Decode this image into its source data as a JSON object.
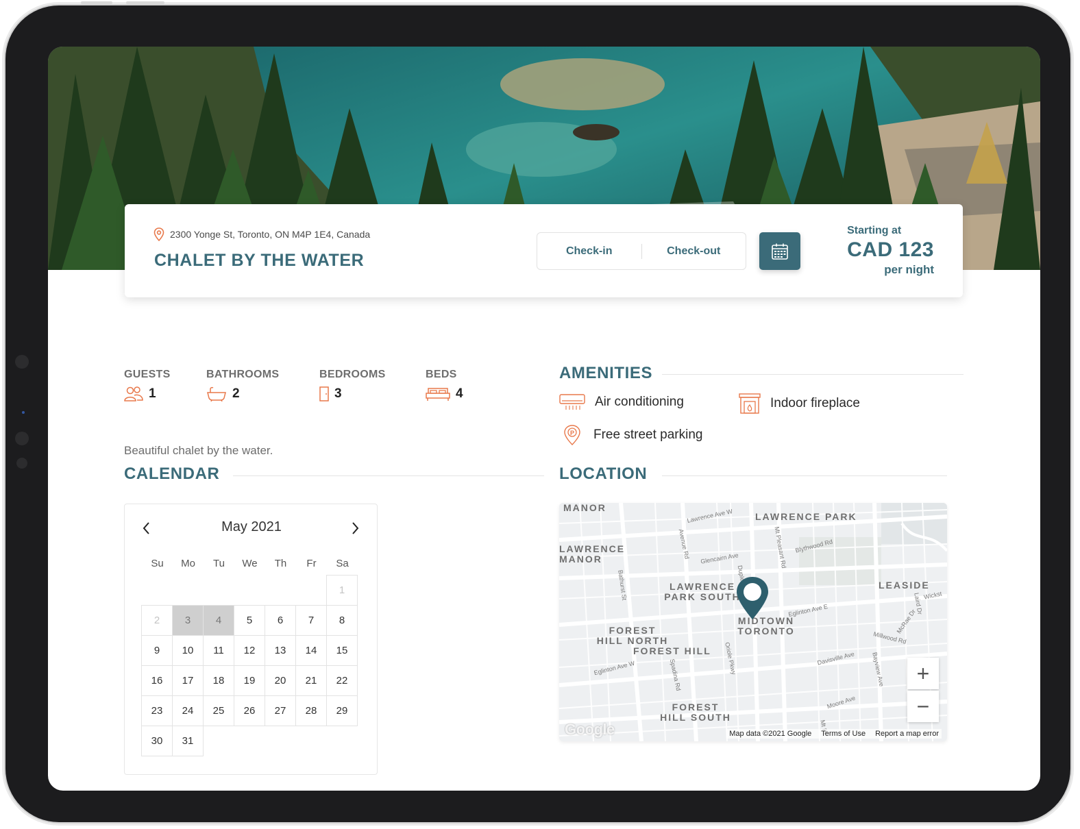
{
  "listing": {
    "address": "2300 Yonge St, Toronto, ON M4P 1E4, Canada",
    "title": "CHALET BY THE WATER",
    "checkin_label": "Check-in",
    "checkout_label": "Check-out",
    "price_prefix": "Starting at",
    "price": "CAD 123",
    "price_suffix": "per night",
    "description": "Beautiful chalet by the water."
  },
  "stats": [
    {
      "label": "GUESTS",
      "value": "1",
      "icon": "guests-icon"
    },
    {
      "label": "BATHROOMS",
      "value": "2",
      "icon": "bathtub-icon"
    },
    {
      "label": "BEDROOMS",
      "value": "3",
      "icon": "door-icon"
    },
    {
      "label": "BEDS",
      "value": "4",
      "icon": "bed-icon"
    }
  ],
  "amenities": {
    "heading": "AMENITIES",
    "items": [
      {
        "label": "Air conditioning",
        "icon": "air-conditioner-icon"
      },
      {
        "label": "Indoor fireplace",
        "icon": "fireplace-icon"
      },
      {
        "label": "Free street parking",
        "icon": "parking-icon"
      }
    ]
  },
  "calendar": {
    "heading": "CALENDAR",
    "month": "May 2021",
    "weekdays": [
      "Su",
      "Mo",
      "Tu",
      "We",
      "Th",
      "Fr",
      "Sa"
    ],
    "weeks": [
      [
        "",
        "",
        "",
        "",
        "",
        "",
        "1"
      ],
      [
        "2",
        "3",
        "4",
        "5",
        "6",
        "7",
        "8"
      ],
      [
        "9",
        "10",
        "11",
        "12",
        "13",
        "14",
        "15"
      ],
      [
        "16",
        "17",
        "18",
        "19",
        "20",
        "21",
        "22"
      ],
      [
        "23",
        "24",
        "25",
        "26",
        "27",
        "28",
        "29"
      ],
      [
        "30",
        "31",
        "",
        "",
        "",
        "",
        ""
      ]
    ],
    "disabled_days": [
      "1",
      "2"
    ],
    "selected_days": [
      "3",
      "4"
    ]
  },
  "location": {
    "heading": "LOCATION",
    "neighborhoods": [
      "MANOR",
      "LAWRENCE PARK",
      "LAWRENCE MANOR",
      "LAWRENCE PARK SOUTH",
      "LEASIDE",
      "MIDTOWN TORONTO",
      "FOREST HILL NORTH",
      "FOREST HILL",
      "FOREST HILL SOUTH"
    ],
    "streets": [
      "Lawrence Ave W",
      "Avenue Rd",
      "Mt Pleasant Rd",
      "Blythwood Rd",
      "Glencairn Ave",
      "Bathurst St",
      "Duplex",
      "Eglinton Ave E",
      "Wickst",
      "Laird Dr",
      "McRae Dr",
      "Millwood Rd",
      "Eglinton Ave W",
      "Oriole Pkwy",
      "Davisville Ave",
      "Bayview Ave",
      "Spadina Rd",
      "Moore Ave",
      "Mt Pl"
    ],
    "zoom_in": "+",
    "zoom_out": "−",
    "google_logo": "Google",
    "map_data": "Map data ©2021 Google",
    "terms": "Terms of Use",
    "report": "Report a map error"
  },
  "colors": {
    "accent": "#3b6b79",
    "icon_orange": "#e8784a"
  }
}
